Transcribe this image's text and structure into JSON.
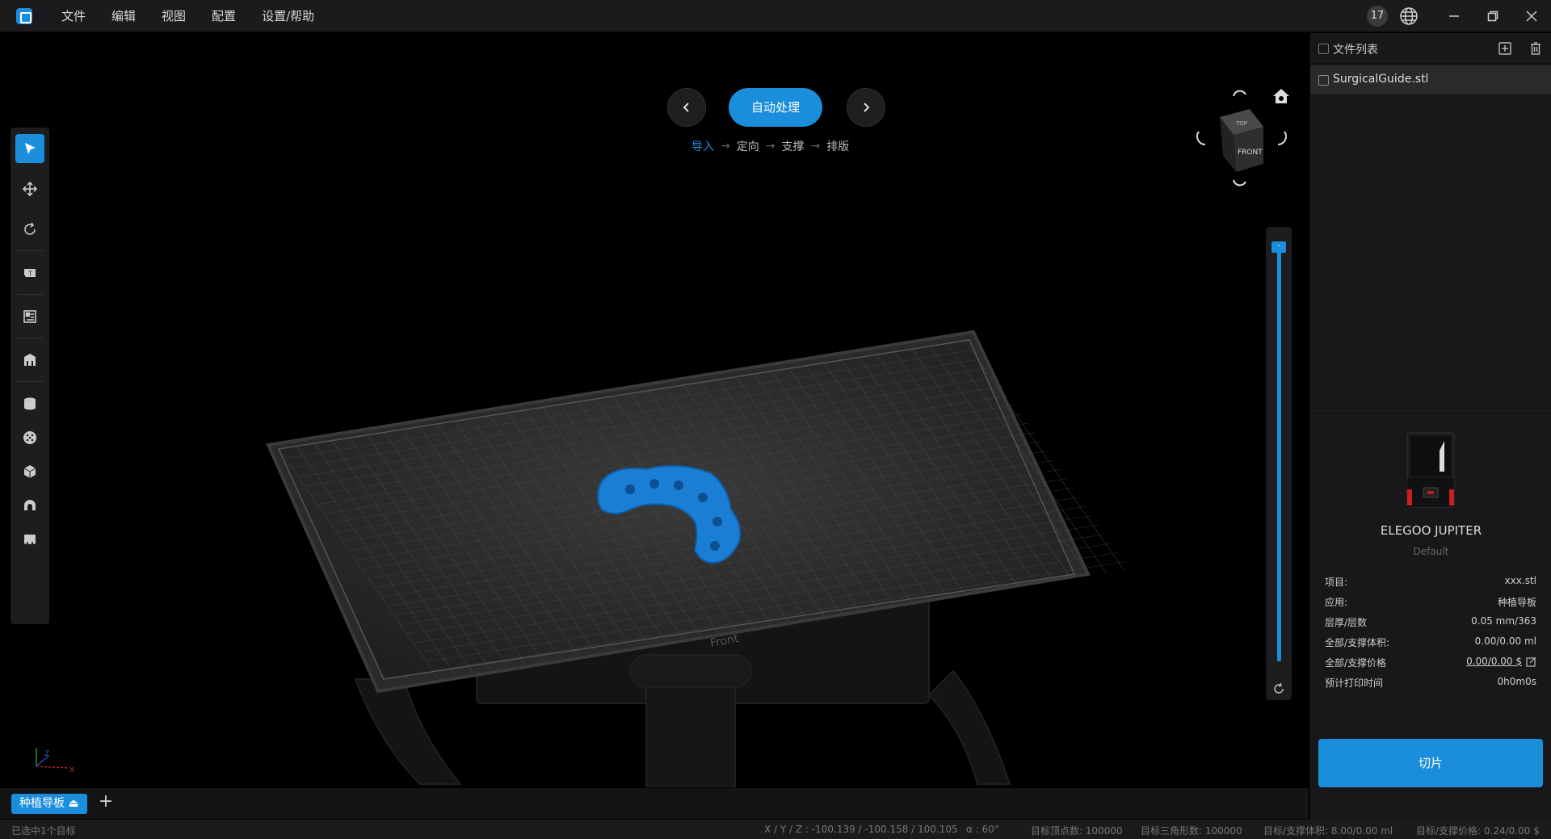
{
  "menu": {
    "items": [
      "文件",
      "编辑",
      "视图",
      "配置",
      "设置/帮助"
    ]
  },
  "window": {
    "notification_count": "17"
  },
  "workflow": {
    "auto_process_label": "自动处理",
    "steps": [
      "导入",
      "定向",
      "支撑",
      "排版"
    ],
    "active_step": 0
  },
  "viewport": {
    "plate_label": "Front",
    "view_cube_top": "TOP",
    "view_cube_front": "FRONT",
    "model_color": "#1a7fd4"
  },
  "layer_slider": {
    "handle_label": "-"
  },
  "tabs": {
    "active_label": "种植导板 ⏏"
  },
  "file_list": {
    "title": "文件列表",
    "files": [
      "SurgicalGuide.stl"
    ]
  },
  "printer": {
    "name": "ELEGOO JUPITER",
    "profile": "Default",
    "info": [
      {
        "label": "项目:",
        "value": "xxx.stl"
      },
      {
        "label": "应用:",
        "value": "种植导板"
      },
      {
        "label": "层厚/层数",
        "value": "0.05 mm/363"
      },
      {
        "label": "全部/支撑体积:",
        "value": "0.00/0.00 ml"
      },
      {
        "label": "全部/支撑价格",
        "value": "0.00/0.00 $"
      },
      {
        "label": "预计打印时间",
        "value": "0h0m0s"
      }
    ],
    "slice_label": "切片"
  },
  "status": {
    "selected": "已选中1个目标",
    "xyz": "X / Y / Z :  -100.139 / -100.158 / 100.105",
    "alpha": "α : 60°",
    "vertices": "目标顶点数: 100000",
    "triangles": "目标三角形数: 100000",
    "volume": "目标/支撑体积: 8.00/0.00  ml",
    "price": "目标/支撑价格: 0.24/0.00  $"
  },
  "colors": {
    "accent": "#1a8ddb",
    "panel": "#18181a",
    "background": "#000000"
  }
}
